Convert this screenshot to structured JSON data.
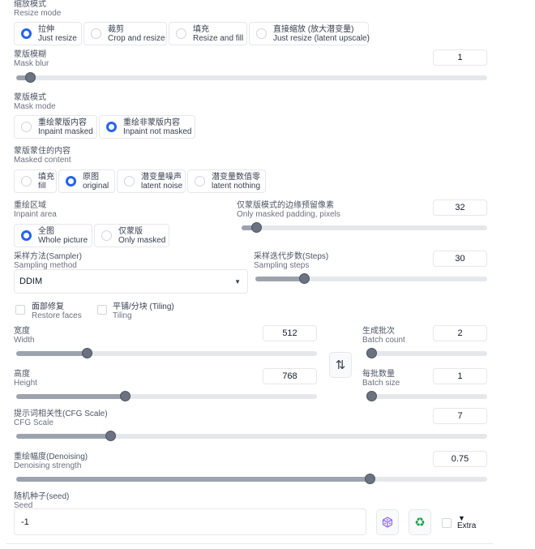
{
  "resize_mode": {
    "label_zh": "缩放模式",
    "label_en": "Resize mode",
    "options": [
      {
        "zh": "拉伸",
        "en": "Just resize",
        "selected": true
      },
      {
        "zh": "裁剪",
        "en": "Crop and resize",
        "selected": false
      },
      {
        "zh": "填充",
        "en": "Resize and fill",
        "selected": false
      },
      {
        "zh": "直接缩放 (放大潜变量)",
        "en": "Just resize (latent upscale)",
        "selected": false
      }
    ]
  },
  "mask_blur": {
    "label_zh": "蒙版模糊",
    "label_en": "Mask blur",
    "value": "1",
    "level": 0.03
  },
  "mask_mode": {
    "label_zh": "蒙版模式",
    "label_en": "Mask mode",
    "options": [
      {
        "zh": "重绘蒙版内容",
        "en": "Inpaint masked",
        "selected": false
      },
      {
        "zh": "重绘非蒙版内容",
        "en": "Inpaint not masked",
        "selected": true
      }
    ]
  },
  "masked_content": {
    "label_zh": "蒙版蒙住的内容",
    "label_en": "Masked content",
    "options": [
      {
        "zh": "填充",
        "en": "fill",
        "selected": false
      },
      {
        "zh": "原图",
        "en": "original",
        "selected": true
      },
      {
        "zh": "潜变量噪声",
        "en": "latent noise",
        "selected": false
      },
      {
        "zh": "潜变量数值零",
        "en": "latent nothing",
        "selected": false
      }
    ]
  },
  "inpaint_area": {
    "label_zh": "重绘区域",
    "label_en": "Inpaint area",
    "options": [
      {
        "zh": "全图",
        "en": "Whole picture",
        "selected": true
      },
      {
        "zh": "仅蒙版",
        "en": "Only masked",
        "selected": false
      }
    ]
  },
  "padding": {
    "label_zh": "仅蒙版模式的边缘预留像素",
    "label_en": "Only masked padding, pixels",
    "value": "32",
    "level": 0.06
  },
  "sampler": {
    "label_zh": "采样方法(Sampler)",
    "label_en": "Sampling method",
    "value": "DDIM"
  },
  "steps": {
    "label_zh": "采样迭代步数(Steps)",
    "label_en": "Sampling steps",
    "value": "30",
    "level": 0.21
  },
  "restore_faces": {
    "label_zh": "面部修复",
    "label_en": "Restore faces",
    "checked": false
  },
  "tiling": {
    "label_zh": "平铺/分块 (Tiling)",
    "label_en": "Tiling",
    "checked": false
  },
  "width": {
    "label_zh": "宽度",
    "label_en": "Width",
    "value": "512",
    "level": 0.235
  },
  "height": {
    "label_zh": "高度",
    "label_en": "Height",
    "value": "768",
    "level": 0.36
  },
  "swap_icon": "⇅",
  "batch_count": {
    "label_zh": "生成批次",
    "label_en": "Batch count",
    "value": "2",
    "level": 0.01
  },
  "batch_size": {
    "label_zh": "每批数量",
    "label_en": "Batch size",
    "value": "1",
    "level": 0.0
  },
  "cfg": {
    "label_zh": "提示词相关性(CFG Scale)",
    "label_en": "CFG Scale",
    "value": "7",
    "level": 0.2
  },
  "denoise": {
    "label_zh": "重绘幅度(Denoising)",
    "label_en": "Denoising strength",
    "value": "0.75",
    "level": 0.75
  },
  "seed": {
    "label_zh": "随机种子(seed)",
    "label_en": "Seed",
    "value": "-1"
  },
  "extra": {
    "arrow": "▼",
    "label": "Extra"
  },
  "colors": {
    "accent": "#2563eb",
    "recycle": "#16a34a",
    "dice": "#8b5cf6"
  }
}
